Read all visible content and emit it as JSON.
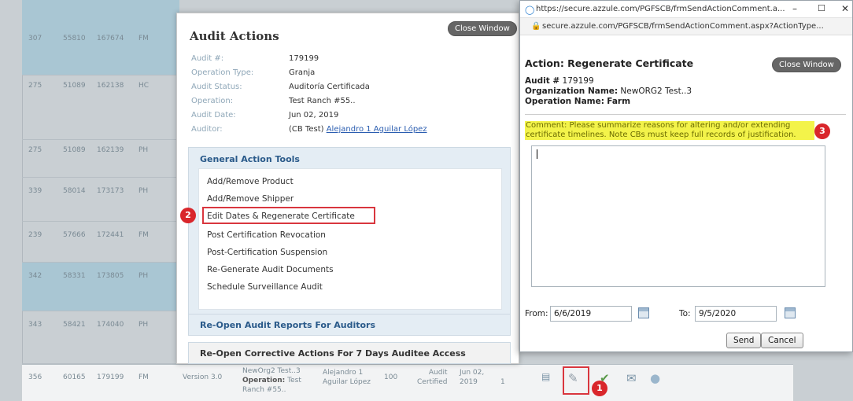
{
  "background": {
    "rows": [
      {
        "c1": "307",
        "c2": "55810",
        "c3": "167674",
        "c4": "FM"
      },
      {
        "c1": "275",
        "c2": "51089",
        "c3": "162138",
        "c4": "HC"
      },
      {
        "c1": "275",
        "c2": "51089",
        "c3": "162139",
        "c4": "PH"
      },
      {
        "c1": "339",
        "c2": "58014",
        "c3": "173173",
        "c4": "PH"
      },
      {
        "c1": "239",
        "c2": "57666",
        "c3": "172441",
        "c4": "FM"
      },
      {
        "c1": "342",
        "c2": "58331",
        "c3": "173805",
        "c4": "PH"
      },
      {
        "c1": "343",
        "c2": "58421",
        "c3": "174040",
        "c4": "PH"
      }
    ],
    "bottom_row": {
      "c1": "356",
      "c2": "60165",
      "c3": "179199",
      "c4": "FM",
      "version": "Version 3.0",
      "org_line1": "NewOrg2 Test..3",
      "org_op_label": "Operation:",
      "org_op_value": "Test",
      "org_line3": "Ranch #55..",
      "auditor_line1": "Alejandro 1",
      "auditor_line2": "Aguilar López",
      "score": "100",
      "status_line1": "Audit",
      "status_line2": "Certified",
      "date_line1": "Jun 02,",
      "date_line2": "2019",
      "count": "1"
    }
  },
  "audit_panel": {
    "title": "Audit Actions",
    "close_label": "Close Window",
    "info": [
      {
        "label": "Audit #:",
        "value": "179199"
      },
      {
        "label": "Operation Type:",
        "value": "Granja"
      },
      {
        "label": "Audit Status:",
        "value": "Auditoría Certificada"
      },
      {
        "label": "Operation:",
        "value": "Test Ranch #55.."
      },
      {
        "label": "Audit Date:",
        "value": "Jun 02, 2019"
      }
    ],
    "auditor_label": "Auditor:",
    "auditor_prefix": "(CB Test)",
    "auditor_link": "Alejandro 1 Aguilar López",
    "tools_heading": "General Action Tools",
    "tools": [
      "Add/Remove Product",
      "Add/Remove Shipper",
      "Edit Dates & Regenerate Certificate",
      "Post Certification Revocation",
      "Post-Certification Suspension",
      "Re-Generate Audit Documents",
      "Schedule Surveillance Audit"
    ],
    "section1": "Re-Open Audit Reports For Auditors",
    "section2": "Re-Open Corrective Actions For 7 Days Auditee Access"
  },
  "popup": {
    "window_title": "https://secure.azzule.com/PGFSCB/frmSendActionComment.a...",
    "address": "secure.azzule.com/PGFSCB/frmSendActionComment.aspx?ActionType...",
    "action_title": "Action: Regenerate Certificate",
    "close_label": "Close Window",
    "audit_label": "Audit #",
    "audit_value": "179199",
    "org_label": "Organization Name:",
    "org_value": "NewORG2 Test..3",
    "op_label": "Operation Name:",
    "op_value": "Farm",
    "comment_note": "Comment: Please summarize reasons for altering and/or extending certificate timelines. Note CBs must keep full records of justification.",
    "comment_value": "",
    "from_label": "From:",
    "from_value": "6/6/2019",
    "to_label": "To:",
    "to_value": "9/5/2020",
    "send_label": "Send",
    "cancel_label": "Cancel"
  },
  "badges": {
    "b1": "1",
    "b2": "2",
    "b3": "3"
  },
  "colors": {
    "accent_red": "#d9262b",
    "highlight_yellow": "#f3f34a",
    "section_blue": "#2a5a8a"
  }
}
